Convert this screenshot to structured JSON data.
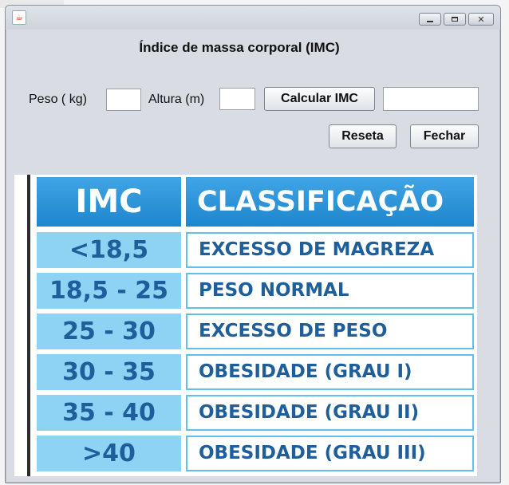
{
  "window": {
    "title": "",
    "icon": "java-cup-icon"
  },
  "form": {
    "title": "Índice de massa corporal (IMC)",
    "peso_label": "Peso ( kg)",
    "peso_value": "",
    "altura_label": "Altura (m)",
    "altura_value": "",
    "calcular_label": "Calcular IMC",
    "result_value": "",
    "reseta_label": "Reseta",
    "fechar_label": "Fechar"
  },
  "imc_table": {
    "headers": [
      "IMC",
      "CLASSIFICAÇÃO"
    ],
    "rows": [
      {
        "imc": "<18,5",
        "classificacao": "EXCESSO DE MAGREZA"
      },
      {
        "imc": "18,5 - 25",
        "classificacao": "PESO NORMAL"
      },
      {
        "imc": "25 - 30",
        "classificacao": "EXCESSO DE PESO"
      },
      {
        "imc": "30 - 35",
        "classificacao": "OBESIDADE (GRAU I)"
      },
      {
        "imc": "35 - 40",
        "classificacao": "OBESIDADE (GRAU II)"
      },
      {
        "imc": ">40",
        "classificacao": "OBESIDADE (GRAU III)"
      }
    ]
  },
  "colors": {
    "window_bg": "#d9dce3",
    "header_blue": "#2f95d8",
    "imc_cell": "#8ed3f3",
    "text_blue": "#1e5f9b",
    "border_blue": "#5fc0ec"
  }
}
